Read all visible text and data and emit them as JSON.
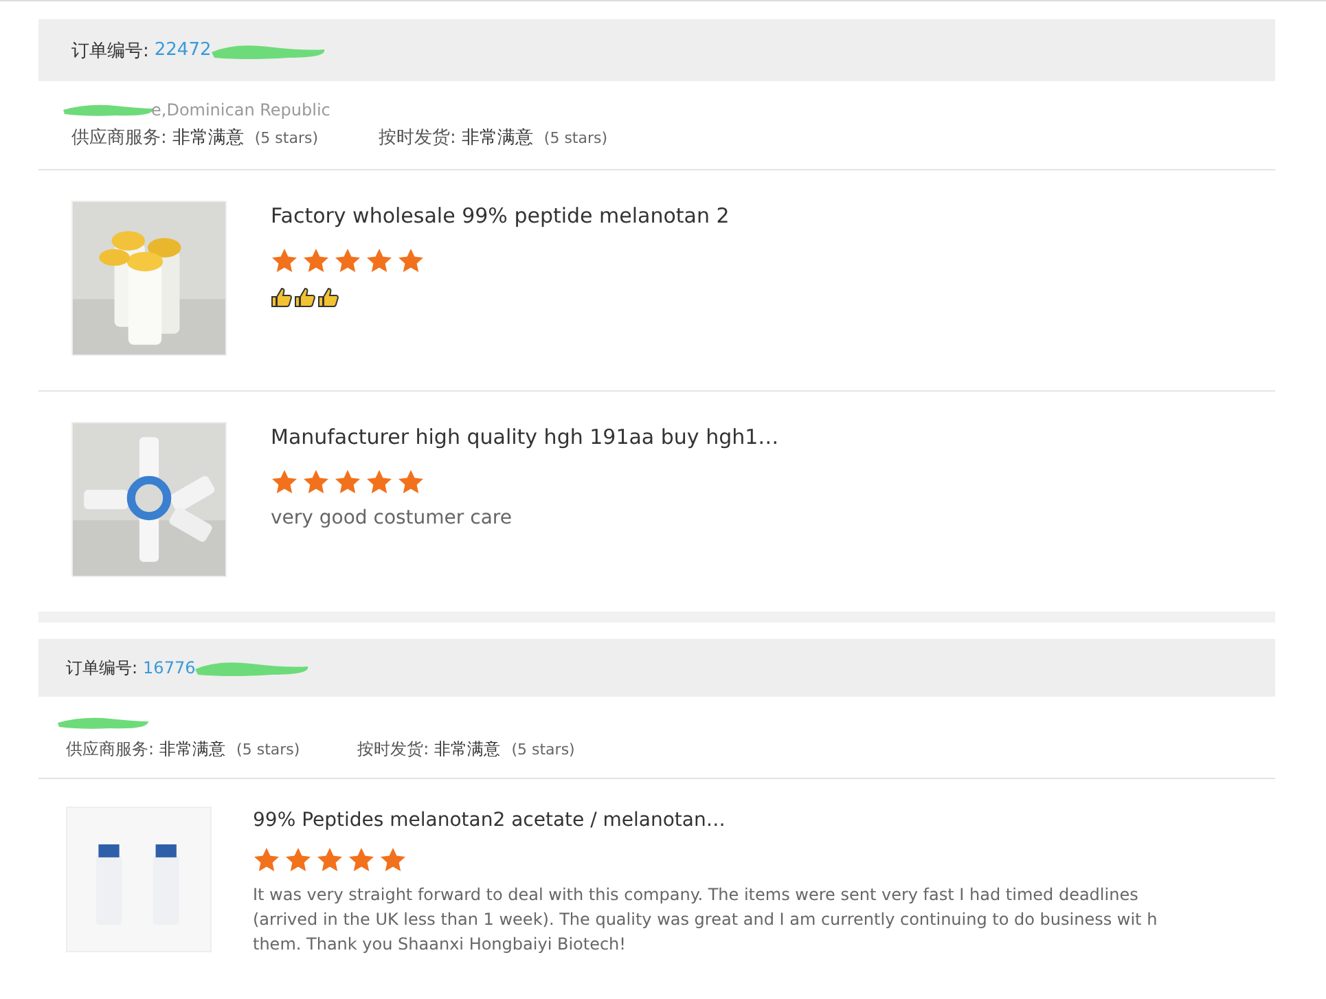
{
  "orders": [
    {
      "order_label": "订单编号:",
      "order_no": "22472",
      "redacted": true,
      "location": "e,Dominican Republic",
      "ratings": [
        {
          "label": "供应商服务:",
          "value": "非常满意",
          "stars_text": "(5 stars)"
        },
        {
          "label": "按时发货:",
          "value": "非常满意",
          "stars_text": "(5 stars)"
        }
      ],
      "items": [
        {
          "title": "Factory wholesale 99% peptide melanotan 2",
          "stars": 5,
          "reactions": [
            {
              "kind": "thumbs_up"
            },
            {
              "kind": "thumbs_up"
            },
            {
              "kind": "thumbs_up"
            }
          ]
        },
        {
          "title": "Manufacturer high quality hgh 191aa buy hgh1…",
          "stars": 5,
          "comment": "very good costumer care"
        }
      ]
    },
    {
      "order_label": "订单编号:",
      "order_no": "16776",
      "redacted": true,
      "ratings": [
        {
          "label": "供应商服务:",
          "value": "非常满意",
          "stars_text": "(5 stars)"
        },
        {
          "label": "按时发货:",
          "value": "非常满意",
          "stars_text": "(5 stars)"
        }
      ],
      "items": [
        {
          "title": "99% Peptides melanotan2 acetate / melanotan…",
          "stars": 5,
          "comment": "It was very straight forward to deal with this company. The items were sent very fast I had timed deadlines (arrived in the UK less than 1 week). The quality was great and I am currently continuing to do business wit h them. Thank you Shaanxi Hongbaiyi Biotech!"
        }
      ]
    }
  ]
}
